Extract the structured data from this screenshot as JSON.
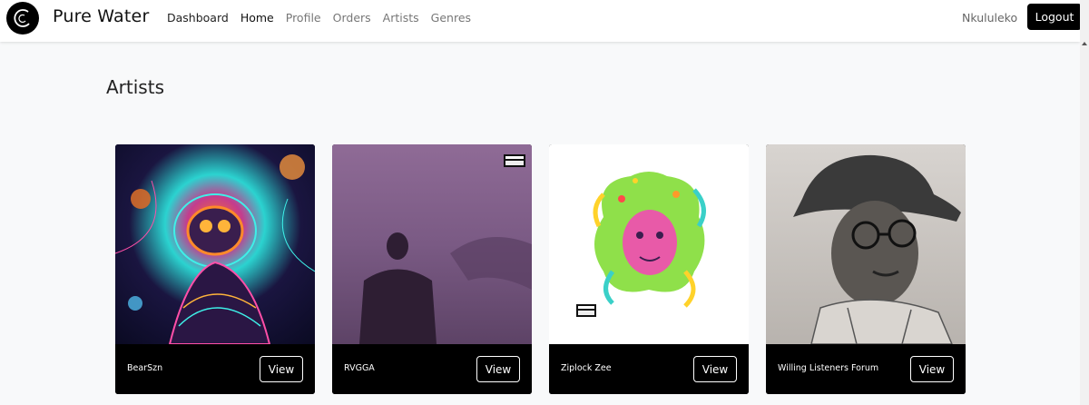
{
  "app": {
    "brand": "Pure Water"
  },
  "nav": {
    "links": [
      {
        "label": "Dashboard"
      },
      {
        "label": "Home"
      },
      {
        "label": "Profile"
      },
      {
        "label": "Orders"
      },
      {
        "label": "Artists"
      },
      {
        "label": "Genres"
      }
    ],
    "username": "Nkululeko",
    "logout_label": "Logout"
  },
  "page": {
    "title": "Artists"
  },
  "artists": [
    {
      "name": "BearSzn",
      "view_label": "View",
      "image_icon": "cosmic-astronaut-artwork"
    },
    {
      "name": "RVGGA",
      "view_label": "View",
      "image_icon": "artist-portrait-purple"
    },
    {
      "name": "Ziplock Zee",
      "view_label": "View",
      "image_icon": "colorful-medusa-artwork"
    },
    {
      "name": "Willing Listeners Forum",
      "view_label": "View",
      "image_icon": "pencil-sketch-portrait"
    }
  ],
  "colors": {
    "navbar_bg": "#ffffff",
    "page_bg": "#f8f9fa",
    "card_footer_bg": "#000000",
    "logout_bg": "#000000"
  }
}
